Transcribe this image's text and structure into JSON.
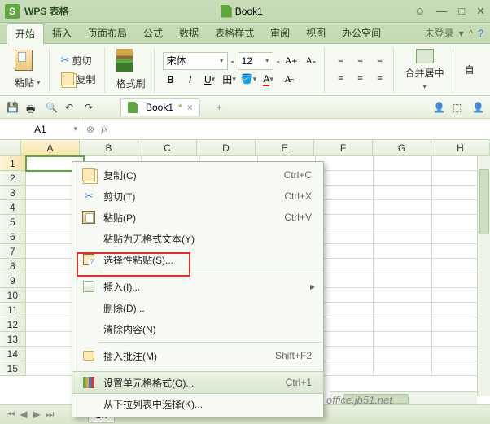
{
  "title": {
    "app": "WPS 表格",
    "doc": "Book1"
  },
  "menu": {
    "tabs": [
      "开始",
      "插入",
      "页面布局",
      "公式",
      "数据",
      "表格样式",
      "审阅",
      "视图",
      "办公空间"
    ],
    "login": "未登录"
  },
  "ribbon": {
    "cut": "剪切",
    "copy": "复制",
    "paste": "粘贴",
    "format_painter": "格式刷",
    "font_name": "宋体",
    "font_size": "12",
    "merge": "合并居中",
    "auto": "自"
  },
  "qat": {
    "doc": "Book1"
  },
  "namebox": "A1",
  "cols": [
    "A",
    "B",
    "C",
    "D",
    "E",
    "F",
    "G",
    "H"
  ],
  "rows": [
    "1",
    "2",
    "3",
    "4",
    "5",
    "6",
    "7",
    "8",
    "9",
    "10",
    "11",
    "12",
    "13",
    "14",
    "15"
  ],
  "context": [
    {
      "icon": "copy",
      "label": "复制(C)",
      "shortcut": "Ctrl+C"
    },
    {
      "icon": "cut",
      "label": "剪切(T)",
      "shortcut": "Ctrl+X"
    },
    {
      "icon": "paste",
      "label": "粘贴(P)",
      "shortcut": "Ctrl+V"
    },
    {
      "icon": "",
      "label": "粘贴为无格式文本(Y)",
      "shortcut": ""
    },
    {
      "icon": "clipq",
      "label": "选择性粘贴(S)...",
      "shortcut": "",
      "boxed": true
    },
    {
      "sep": true
    },
    {
      "icon": "insert",
      "label": "插入(I)...",
      "shortcut": "",
      "sub": true
    },
    {
      "icon": "",
      "label": "删除(D)...",
      "shortcut": ""
    },
    {
      "icon": "",
      "label": "清除内容(N)",
      "shortcut": ""
    },
    {
      "sep": true
    },
    {
      "icon": "comment",
      "label": "插入批注(M)",
      "shortcut": "Shift+F2"
    },
    {
      "sep": true
    },
    {
      "icon": "format",
      "label": "设置单元格格式(O)...",
      "shortcut": "Ctrl+1",
      "hover": true
    },
    {
      "icon": "",
      "label": "从下拉列表中选择(K)...",
      "shortcut": ""
    }
  ],
  "sheet": "Sh"
}
